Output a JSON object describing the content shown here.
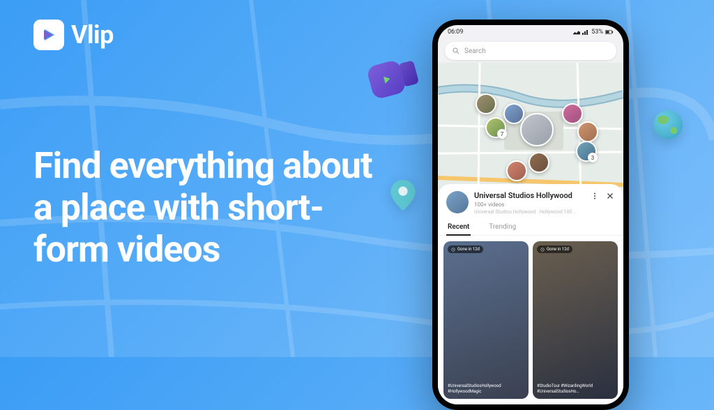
{
  "brand": {
    "name": "Vlip"
  },
  "headline": "Find everything about a place with short-form videos",
  "phone": {
    "status": {
      "time": "06:09",
      "battery": "53%"
    },
    "search": {
      "placeholder": "Search"
    },
    "map_pins": [
      {
        "badge": ""
      },
      {
        "badge": "7"
      },
      {
        "badge": ""
      },
      {
        "badge": ""
      },
      {
        "badge": ""
      },
      {
        "badge": ""
      },
      {
        "badge": "3"
      },
      {
        "badge": ""
      }
    ],
    "sheet": {
      "title": "Universal Studios Hollywood",
      "subtitle": "100+ videos",
      "meta": "Universal Studios Hollywood · Hollywood 100 …",
      "tabs": [
        "Recent",
        "Trending"
      ],
      "active_tab": 0,
      "cards": [
        {
          "badge": "Gone in 12d",
          "caption": "#UniversalStudiosHollywood #HollywoodMagic"
        },
        {
          "badge": "Gone in 12d",
          "caption": "#StudioTour #WizardingWorld #UniversalStudiosHo…"
        }
      ]
    }
  }
}
